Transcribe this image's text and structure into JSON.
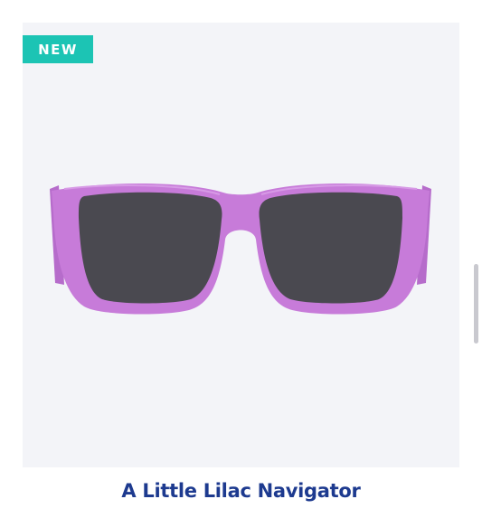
{
  "product": {
    "badge": "NEW",
    "title": "A Little Lilac Navigator",
    "image_icon": "sunglasses-image"
  },
  "colors": {
    "badge_bg": "#1cc4b4",
    "title": "#1d3a8f",
    "frame": "#c77bd9",
    "lens": "#4a4950",
    "panel_bg": "#f3f4f8"
  }
}
